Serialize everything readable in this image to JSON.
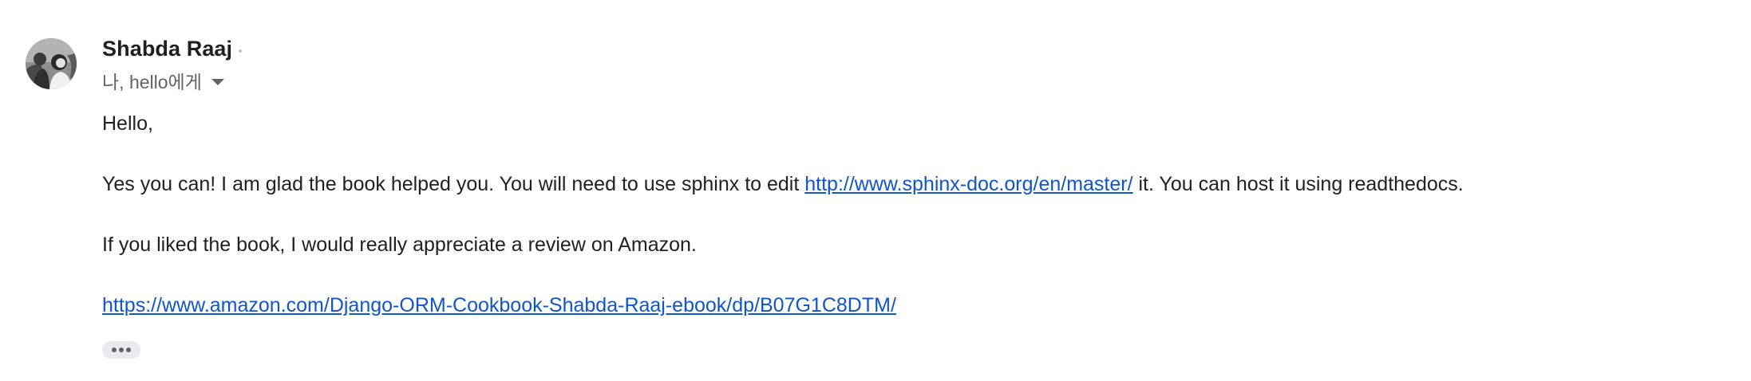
{
  "sender": {
    "name": "Shabda Raaj",
    "recipients": "나, hello에게"
  },
  "body": {
    "greeting": "Hello,",
    "paragraph1_before": "Yes you can! I am glad the book helped you. You will need to use sphinx to edit ",
    "paragraph1_link": "http://www.sphinx-doc.org/en/master/",
    "paragraph1_after": " it. You can host it using readthedocs.",
    "paragraph2": "If you liked the book, I would really appreciate a review on Amazon.",
    "amazon_link": "https://www.amazon.com/Django-ORM-Cookbook-Shabda-Raaj-ebook/dp/B07G1C8DTM/"
  },
  "icons": {
    "avatar": "avatar-photo",
    "recipient_dropdown": "chevron-down-icon",
    "show_trimmed": "more-horizontal-icon"
  },
  "colors": {
    "link": "#1155cc",
    "secondary_text": "#5f6368",
    "primary_text": "#202124"
  }
}
